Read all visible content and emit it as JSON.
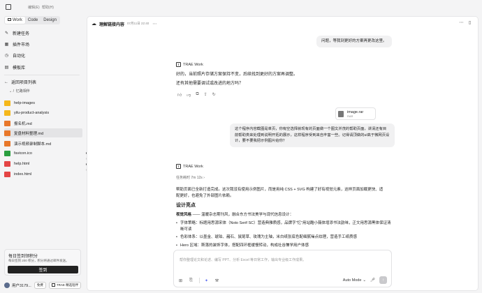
{
  "topbar": {
    "menu1": "编辑(E)",
    "menu2": "帮助(H)"
  },
  "mode_tabs": [
    "Work",
    "Code",
    "Design"
  ],
  "nav": [
    {
      "label": "新建任务",
      "icon": "edit-icon"
    },
    {
      "label": "插件市场",
      "icon": "store-icon"
    },
    {
      "label": "自动化",
      "icon": "clock-icon"
    },
    {
      "label": "模板库",
      "icon": "template-icon"
    }
  ],
  "back_label": "返回项目列表",
  "path": "忆路相伴",
  "files": [
    {
      "name": "help-images",
      "type": "folder"
    },
    {
      "name": "yilu-product-analysis",
      "type": "folder"
    },
    {
      "name": "报名机.md",
      "type": "md"
    },
    {
      "name": "复盘材料整理.md",
      "type": "md",
      "active": true
    },
    {
      "name": "演示视频录制脚本.md",
      "type": "md"
    },
    {
      "name": "favicon.ico",
      "type": "ico"
    },
    {
      "name": "help.html",
      "type": "doc"
    },
    {
      "name": "index.html",
      "type": "doc"
    }
  ],
  "sign_card": {
    "title": "每日签到领积分",
    "subtitle": "每日签到 200 积分，积分将通过邮件发送。",
    "button": "签到"
  },
  "user": {
    "name": "用户3179...",
    "badge": "免费",
    "work_btn": "TRAE 精选陪伴"
  },
  "main": {
    "title": "理解链接内容",
    "time": "07月11日 22:40",
    "user_msg1": "问题，等我到更好的方案再更改这里。",
    "bot_name": "TRAE Work",
    "bot_msg1_l1": "好的，当前照片存储方案保持不变，后续找到更好的方案再调整。",
    "bot_msg1_l2": "还有其他需要调试或改进的地方吗？",
    "attachment": {
      "name": "image.rar",
      "size": "RAR"
    },
    "user_msg2": "这个程序内容截图是单页，你有空选择就现有的页面做一个图文并茂的帮助页面，讲清还有目前帮助类来处理到说明开拓的展示，这样程序受到来自丰富一些。记得请顶做的ui高于微网页设计，要不要我把示例图片给你？",
    "thinking": "任务耗时 7m 12s",
    "bot_msg2": "帮助页面已全新打造完成。这次我没有使用示例图片，而是用纯 CSS + SVG 构建了好有视觉元素，这样页面加载更快、适配更好，也避免了外部图片依赖。",
    "section_title": "设计亮点",
    "style_line_label": "视觉风格",
    "style_line": "—— 温暖杂志期刊风，融合东方书法美学与现代信息设计：",
    "bullets": [
      "字体策略：标题用思源宋体（Noto Serif SC）营造典雅质感，品牌字\"忆\"用站酷小薇体增添书法韵味，正文用思源黑体保证清晰可读",
      "色彩体系：以墨金、琥珀、赭石、鼠尾草、玫瑰为主轴，米白纸张底色配细腻噪点纹理，营造手工纸质感",
      "Hero 区域：斯落的装饰字体，搭配四环框缓慢转动，构成社谷兼学用户体感"
    ],
    "input_placeholder": "帮你整理论文和论述、编写 PPT、分析 Excel 等日常工作，输出专业级工作成果。",
    "mode": "Auto Mode"
  }
}
